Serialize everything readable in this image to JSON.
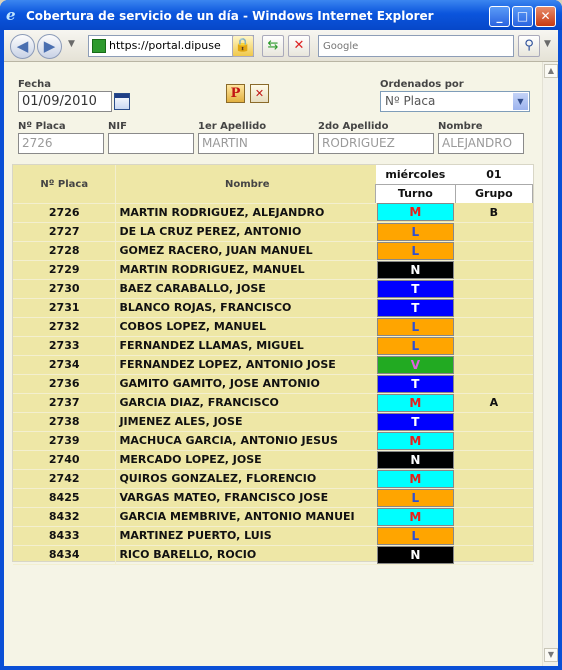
{
  "window": {
    "title": "Cobertura de servicio de un día - Windows Internet Explorer"
  },
  "toolbar": {
    "url": "https://portal.dipuse",
    "search_placeholder": "Google"
  },
  "filters": {
    "fecha_label": "Fecha",
    "fecha_value": "01/09/2010",
    "ordenados_label": "Ordenados por",
    "ordenados_value": "Nº Placa",
    "placa_label": "Nº Placa",
    "placa_value": "2726",
    "nif_label": "NIF",
    "nif_value": "",
    "apellido1_label": "1er Apellido",
    "apellido1_value": "MARTIN",
    "apellido2_label": "2do Apellido",
    "apellido2_value": "RODRIGUEZ",
    "nombre_label": "Nombre",
    "nombre_value": "ALEJANDRO",
    "p_button": "P",
    "x_button": "✕"
  },
  "grid": {
    "col_placa": "Nº Placa",
    "col_nombre": "Nombre",
    "day_name": "miércoles",
    "day_num": "01",
    "col_turno": "Turno",
    "col_grupo": "Grupo",
    "rows": [
      {
        "placa": "2726",
        "nombre": "MARTIN  RODRIGUEZ, ALEJANDRO",
        "turno": "M",
        "grupo": "B"
      },
      {
        "placa": "2727",
        "nombre": "DE LA CRUZ  PEREZ, ANTONIO",
        "turno": "L",
        "grupo": ""
      },
      {
        "placa": "2728",
        "nombre": "GOMEZ  RACERO, JUAN MANUEL",
        "turno": "L",
        "grupo": ""
      },
      {
        "placa": "2729",
        "nombre": "MARTIN  RODRIGUEZ, MANUEL",
        "turno": "N",
        "grupo": ""
      },
      {
        "placa": "2730",
        "nombre": "BAEZ  CARABALLO, JOSE",
        "turno": "T",
        "grupo": ""
      },
      {
        "placa": "2731",
        "nombre": "BLANCO  ROJAS, FRANCISCO",
        "turno": "T",
        "grupo": ""
      },
      {
        "placa": "2732",
        "nombre": "COBOS  LOPEZ, MANUEL",
        "turno": "L",
        "grupo": ""
      },
      {
        "placa": "2733",
        "nombre": "FERNANDEZ  LLAMAS, MIGUEL",
        "turno": "L",
        "grupo": ""
      },
      {
        "placa": "2734",
        "nombre": "FERNANDEZ  LOPEZ, ANTONIO JOSE",
        "turno": "V",
        "grupo": ""
      },
      {
        "placa": "2736",
        "nombre": "GAMITO  GAMITO, JOSE ANTONIO",
        "turno": "T",
        "grupo": ""
      },
      {
        "placa": "2737",
        "nombre": "GARCIA  DIAZ, FRANCISCO",
        "turno": "M",
        "grupo": "A"
      },
      {
        "placa": "2738",
        "nombre": "JIMENEZ  ALES, JOSE",
        "turno": "T",
        "grupo": ""
      },
      {
        "placa": "2739",
        "nombre": "MACHUCA  GARCIA, ANTONIO JESUS",
        "turno": "M",
        "grupo": ""
      },
      {
        "placa": "2740",
        "nombre": "MERCADO  LOPEZ, JOSE",
        "turno": "N",
        "grupo": ""
      },
      {
        "placa": "2742",
        "nombre": "QUIROS  GONZALEZ, FLORENCIO",
        "turno": "M",
        "grupo": ""
      },
      {
        "placa": "8425",
        "nombre": "VARGAS  MATEO, FRANCISCO JOSE",
        "turno": "L",
        "grupo": ""
      },
      {
        "placa": "8432",
        "nombre": "GARCIA  MEMBRIVE, ANTONIO MANUEI",
        "turno": "M",
        "grupo": ""
      },
      {
        "placa": "8433",
        "nombre": "MARTINEZ  PUERTO, LUIS",
        "turno": "L",
        "grupo": ""
      },
      {
        "placa": "8434",
        "nombre": "RICO  BARELLO, ROCIO",
        "turno": "N",
        "grupo": ""
      }
    ]
  },
  "turno_colors": {
    "M": {
      "bg": "#00ffff",
      "fg": "#e8201a"
    },
    "L": {
      "bg": "#ffa500",
      "fg": "#3050d0"
    },
    "N": {
      "bg": "#000000",
      "fg": "#ffffff"
    },
    "T": {
      "bg": "#0000ff",
      "fg": "#ffffff"
    },
    "V": {
      "bg": "#22aa22",
      "fg": "#e060e0"
    }
  }
}
